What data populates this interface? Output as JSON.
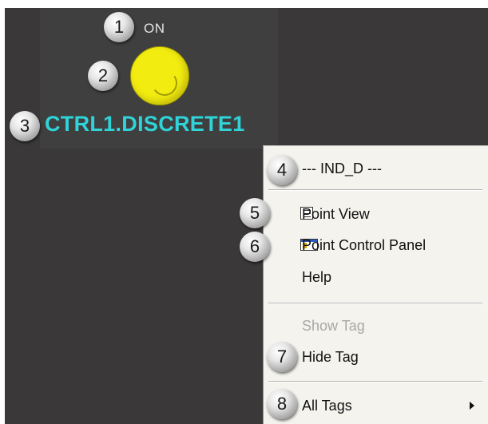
{
  "graphic": {
    "state_label": "ON",
    "tag_name": "CTRL1.DISCRETE1",
    "indicator_color": "#f2ec10",
    "tag_color": "#2fd3d8",
    "background_color": "#3a3838"
  },
  "callouts": [
    "1",
    "2",
    "3",
    "4",
    "5",
    "6",
    "7",
    "8"
  ],
  "context_menu": {
    "header": "--- IND_D ---",
    "items": [
      {
        "label": "Point View",
        "icon": "point-view-icon",
        "enabled": true
      },
      {
        "label": "Point Control Panel",
        "icon": "point-control-panel-icon",
        "enabled": true
      },
      {
        "label": "Help",
        "icon": "",
        "enabled": true
      },
      {
        "label": "Show Tag",
        "icon": "",
        "enabled": false
      },
      {
        "label": "Hide Tag",
        "icon": "",
        "enabled": true
      },
      {
        "label": "All Tags",
        "icon": "submenu-arrow-icon",
        "enabled": true
      }
    ]
  }
}
